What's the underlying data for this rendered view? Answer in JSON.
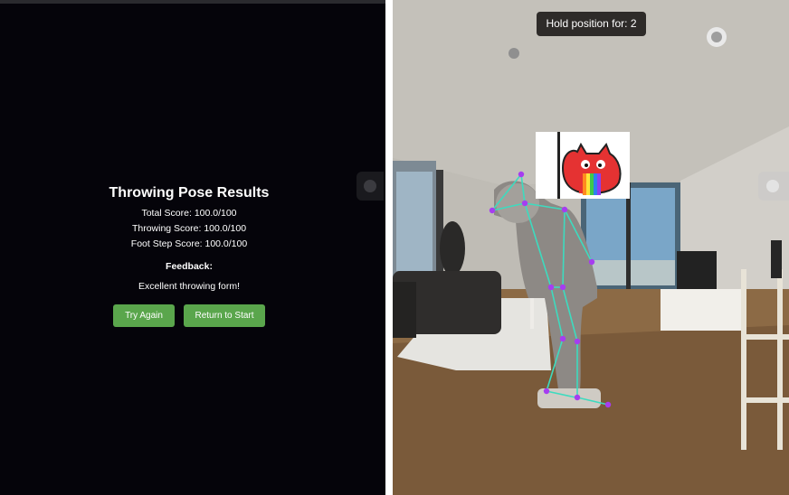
{
  "results": {
    "title": "Throwing Pose Results",
    "total_score": "Total Score: 100.0/100",
    "throwing_score": "Throwing Score: 100.0/100",
    "footstep_score": "Foot Step Score: 100.0/100",
    "feedback_title": "Feedback:",
    "feedback_text": "Excellent throwing form!",
    "try_again_label": "Try Again",
    "return_label": "Return to Start"
  },
  "camera": {
    "hold_text": "Hold position for: 2"
  },
  "colors": {
    "button_green": "#5aa64c",
    "skeleton_line": "#3ddbbf",
    "skeleton_joint": "#a63df0",
    "panel_bg": "#05040a"
  },
  "icons": {
    "sticker": "red-monster-rainbow-sticker",
    "side_handle": "circle-handle-icon"
  }
}
